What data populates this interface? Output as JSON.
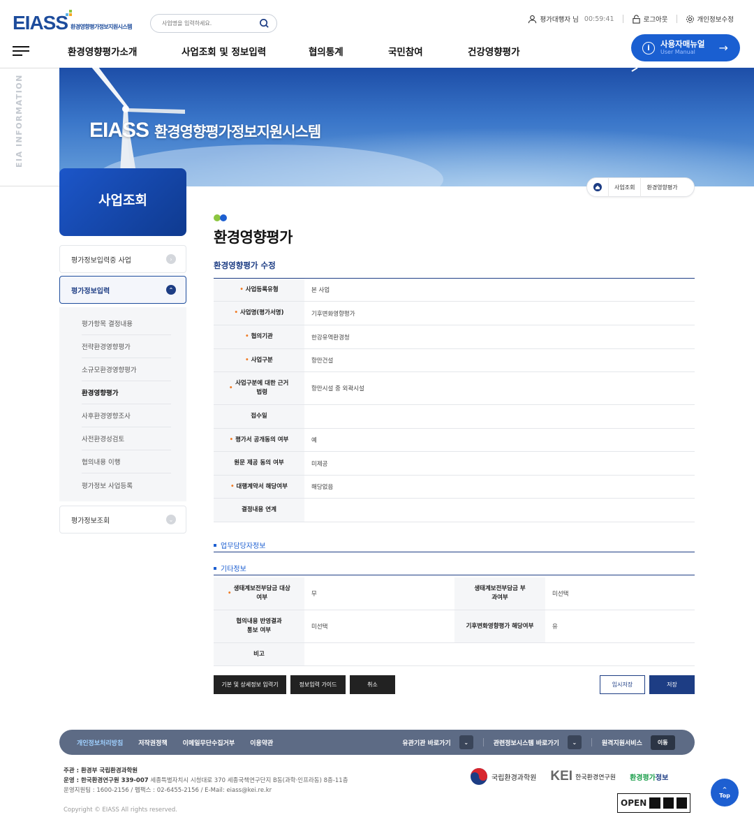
{
  "header": {
    "logo_main": "EIASS",
    "logo_sub": "환경영향평가정보지원시스템",
    "search_placeholder": "사업명을 입력하세요.",
    "user_label": "평가대행자 님",
    "timer": "00:59:41",
    "logout": "로그아웃",
    "profile_edit": "개인정보수정",
    "manual_title": "사용자매뉴얼",
    "manual_sub": "User Manual",
    "gnb": [
      "환경영향평가소개",
      "사업조회 및 정보입력",
      "협의통계",
      "국민참여",
      "건강영향평가"
    ]
  },
  "hero": {
    "side_text": "EIA INFORMATION",
    "title_en": "EIASS",
    "title_kr": "환경영향평가정보지원시스템"
  },
  "breadcrumb": [
    "사업조회",
    "환경영향평가"
  ],
  "lnb": {
    "title": "사업조회",
    "menu": [
      "평가정보입력중 사업",
      "평가정보입력",
      "평가정보조회"
    ],
    "submenu": [
      "평가항목 결정내용",
      "전략환경영향평가",
      "소규모환경영향평가",
      "환경영향평가",
      "사후환경영향조사",
      "사전환경성검토",
      "협의내용 이행",
      "평가정보 사업등록"
    ]
  },
  "content": {
    "page_title": "환경영향평가",
    "section_title": "환경영향평가 수정",
    "rows": [
      {
        "label": "사업등록유형",
        "value": "본 사업",
        "required": true
      },
      {
        "label": "사업명(평가서명)",
        "value": "기후변화영향평가",
        "required": true
      },
      {
        "label": "협의기관",
        "value": "한강유역환경청",
        "required": true
      },
      {
        "label": "사업구분",
        "value": "항만건설",
        "required": true
      },
      {
        "label": "사업구분에 대한 근거법령",
        "value": "항만시설 중 외곽시설",
        "required": true
      },
      {
        "label": "접수일",
        "value": "",
        "required": false
      },
      {
        "label": "평가서 공개동의 여부",
        "value": "예",
        "required": true
      },
      {
        "label": "원문 제공 동의 여부",
        "value": "미제공",
        "required": false
      },
      {
        "label": "대행계약서 해당여부",
        "value": "해당없음",
        "required": true
      },
      {
        "label": "결정내용 연계",
        "value": "",
        "required": false
      }
    ],
    "subsections": [
      "업무담당자정보",
      "기타정보"
    ],
    "etc": {
      "r1": {
        "l1": "생태계보전부담금 대상여부",
        "v1": "무",
        "l2": "생태계보전부담금 부과여부",
        "v2": "미선택"
      },
      "r2": {
        "l1": "협의내용 반영결과 통보 여부",
        "v1": "미선택",
        "l2": "기후변화영향평가 해당여부",
        "v2": "유"
      },
      "r3": {
        "l1": "비고",
        "v1": ""
      }
    },
    "buttons": {
      "basic": "기본 및 상세정보 입력기",
      "guide": "정보입력 가이드",
      "cancel": "취소",
      "temp_save": "임시저장",
      "save": "저장"
    }
  },
  "footer": {
    "links": [
      "개인정보처리방침",
      "저작권정책",
      "이메일무단수집거부",
      "이용약관"
    ],
    "related": "유관기관 바로가기",
    "systems": "관련정보시스템 바로가기",
    "remote": "원격지원서비스",
    "go": "이동",
    "host": "주관 : 환경부 국립환경과학원",
    "operator_label": "운영 : 한국환경연구원 339-007",
    "operator_addr": "세종특별자치시 시청대로 370 세종국책연구단지 B동(과학·인프라동) 8층-11층",
    "contact": "운영지원팀 : 1600-2156 / 펩팩스 : 02-6455-2156 / E-Mail: eiass@kei.re.kr",
    "copyright": "Copyright © EIASS All rights reserved.",
    "logo1": "국립환경과학원",
    "logo2_en": "KEI",
    "logo2_kr": "한국환경연구원",
    "logo3a": "환경평가",
    "logo3b": "정보",
    "open": "OPEN",
    "top": "Top"
  }
}
